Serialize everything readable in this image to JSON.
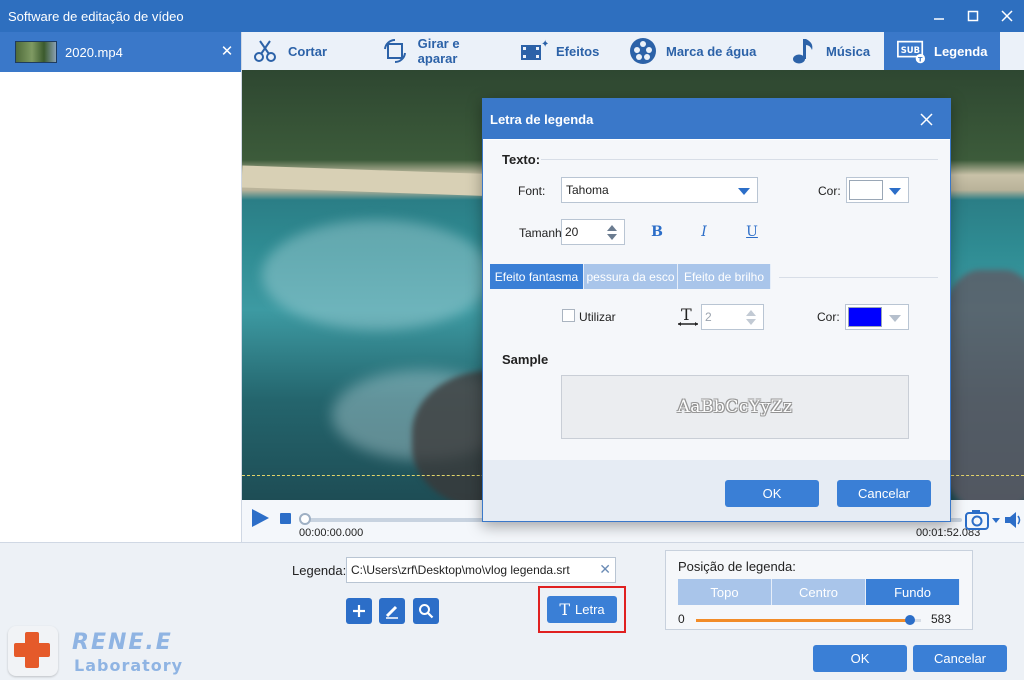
{
  "window": {
    "title": "Software de editação de vídeo",
    "controls": [
      "minimize-icon",
      "maximize-icon",
      "close-icon"
    ]
  },
  "file_list": {
    "items": [
      {
        "name": "2020.mp4"
      }
    ]
  },
  "toolbar": {
    "items": [
      {
        "label": "Cortar",
        "icon": "crop-icon"
      },
      {
        "label": "Girar e aparar",
        "icon": "rotate-crop-icon"
      },
      {
        "label": "Efeitos",
        "icon": "effects-icon"
      },
      {
        "label": "Marca de água",
        "icon": "watermark-icon"
      },
      {
        "label": "Música",
        "icon": "music-icon"
      },
      {
        "label": "Legenda",
        "icon": "subtitle-icon",
        "active": true
      }
    ]
  },
  "player": {
    "time_current": "00:00:00.000",
    "time_total": "00:01:52.083",
    "progress": 0
  },
  "subtitle_file": {
    "label": "Legenda:",
    "path": "C:\\Users\\zrf\\Desktop\\mo\\vlog legenda.srt"
  },
  "letra_button": {
    "label": "Letra"
  },
  "position": {
    "title": "Posição de legenda:",
    "options": [
      "Topo",
      "Centro",
      "Fundo"
    ],
    "selected": "Fundo",
    "slider_min": "0",
    "slider_max": "583",
    "slider_value_fraction": 0.95
  },
  "footer": {
    "ok": "OK",
    "cancel": "Cancelar"
  },
  "logo": {
    "brand": "RENE.E",
    "sub": "Laboratory"
  },
  "dialog": {
    "title": "Letra de legenda",
    "text_section": "Texto:",
    "font_label": "Font:",
    "font_value": "Tahoma",
    "color_label": "Cor:",
    "text_color": "#ffffff",
    "size_label": "Tamanh",
    "size_value": "20",
    "format_buttons": {
      "bold": "B",
      "italic": "I",
      "underline": "U"
    },
    "tabs": [
      "Efeito fantasma",
      "pessura da esco",
      "Efeito de brilho"
    ],
    "active_tab": "Efeito fantasma",
    "use_label": "Utilizar",
    "use_checked": false,
    "thickness_value": "2",
    "effect_color_label": "Cor:",
    "effect_color": "#0000ff",
    "sample_label": "Sample",
    "sample_text": "AaBbCcYyZz",
    "ok": "OK",
    "cancel": "Cancelar"
  },
  "colors": {
    "accent": "#3a7fd6",
    "titlebar": "#2e6fbf",
    "highlight_border": "#e02020",
    "slider_fill": "#f28c28"
  }
}
